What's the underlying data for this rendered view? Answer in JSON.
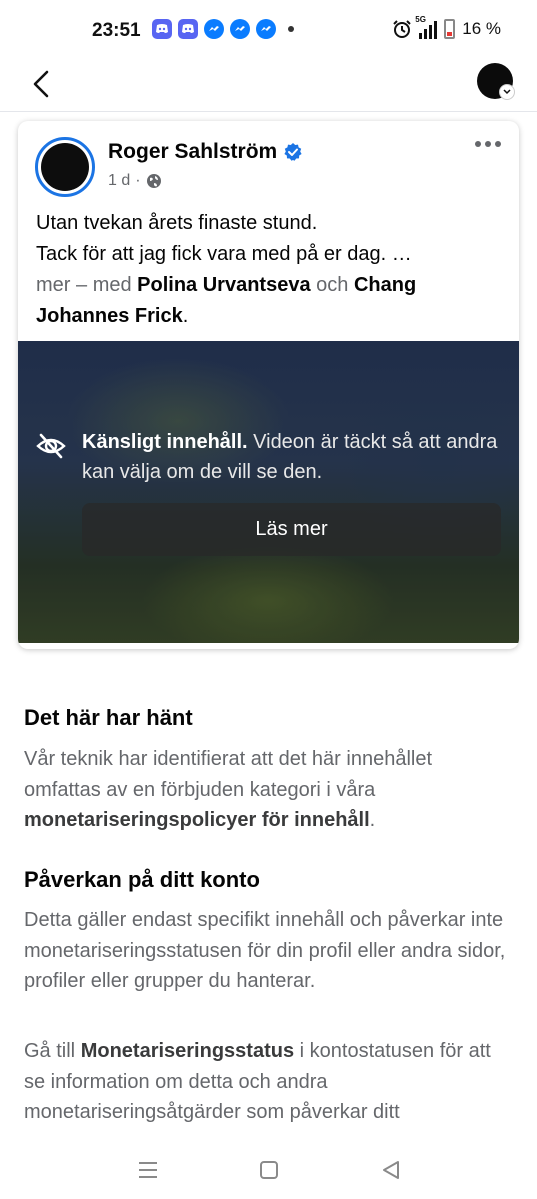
{
  "status_bar": {
    "time": "23:51",
    "battery_pct": "16 %",
    "network": "5G",
    "battery_color": "#e53935",
    "notification_icons": [
      "discord-icon",
      "discord-icon",
      "messenger-icon",
      "messenger-icon",
      "messenger-icon"
    ]
  },
  "header": {
    "back_icon": "chevron-left-icon",
    "profile_icon": "profile-avatar"
  },
  "post": {
    "author": "Roger Sahlström",
    "verified": true,
    "time_ago": "1 d",
    "separator": "·",
    "audience_icon": "globe-icon",
    "text_line1": "Utan tvekan årets finaste stund.",
    "text_line2": "Tack för att jag fick vara med på er dag. …",
    "more_label": "mer",
    "with_label": "– med",
    "tag1": "Polina Urvantseva",
    "and_label": "och",
    "tag2": "Chang Johannes Frick",
    "period": ".",
    "sensitive_title": "Känsligt innehåll.",
    "sensitive_desc": "Videon är täckt så att andra kan välja om de vill se den.",
    "read_more_button": "Läs mer"
  },
  "info": {
    "section1_title": "Det här har hänt",
    "section1_text": "Vår teknik har identifierat att det här innehållet omfattas av en förbjuden kategori i våra",
    "section1_bold": "monetariseringspolicyer för innehåll",
    "section1_end": ".",
    "section2_title": "Påverkan på ditt konto",
    "section2_text": "Detta gäller endast specifikt innehåll och påverkar inte monetariseringsstatusen för din profil eller andra sidor, profiler eller grupper du hanterar.",
    "section3_prefix": "Gå till",
    "section3_bold": "Monetariseringsstatus",
    "section3_text": "i kontostatusen för att se information om detta och andra monetariseringsåtgärder som påverkar ditt"
  },
  "colors": {
    "accent": "#1b74e4",
    "muted_text": "#65676b"
  },
  "nav": {
    "buttons": [
      "recent-apps-icon",
      "home-icon",
      "back-icon"
    ]
  }
}
